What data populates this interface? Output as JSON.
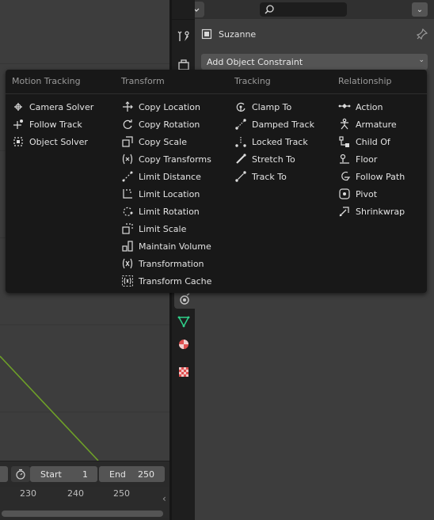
{
  "header": {
    "menu_chevron": "⌄",
    "search_placeholder": ""
  },
  "object": {
    "name": "Suzanne"
  },
  "add_constraint": {
    "label": "Add Object Constraint",
    "chevron": "⌄"
  },
  "menu": {
    "columns": [
      {
        "heading": "Motion Tracking",
        "items": [
          {
            "label": "Camera Solver",
            "icon": "camera-solver-icon"
          },
          {
            "label": "Follow Track",
            "icon": "follow-track-icon"
          },
          {
            "label": "Object Solver",
            "icon": "object-solver-icon"
          }
        ]
      },
      {
        "heading": "Transform",
        "items": [
          {
            "label": "Copy Location",
            "icon": "copy-location-icon"
          },
          {
            "label": "Copy Rotation",
            "icon": "copy-rotation-icon"
          },
          {
            "label": "Copy Scale",
            "icon": "copy-scale-icon"
          },
          {
            "label": "Copy Transforms",
            "icon": "copy-transforms-icon"
          },
          {
            "label": "Limit Distance",
            "icon": "limit-distance-icon"
          },
          {
            "label": "Limit Location",
            "icon": "limit-location-icon"
          },
          {
            "label": "Limit Rotation",
            "icon": "limit-rotation-icon"
          },
          {
            "label": "Limit Scale",
            "icon": "limit-scale-icon"
          },
          {
            "label": "Maintain Volume",
            "icon": "maintain-volume-icon"
          },
          {
            "label": "Transformation",
            "icon": "transformation-icon"
          },
          {
            "label": "Transform Cache",
            "icon": "transform-cache-icon"
          }
        ]
      },
      {
        "heading": "Tracking",
        "items": [
          {
            "label": "Clamp To",
            "icon": "clamp-to-icon"
          },
          {
            "label": "Damped Track",
            "icon": "damped-track-icon"
          },
          {
            "label": "Locked Track",
            "icon": "locked-track-icon"
          },
          {
            "label": "Stretch To",
            "icon": "stretch-to-icon"
          },
          {
            "label": "Track To",
            "icon": "track-to-icon"
          }
        ]
      },
      {
        "heading": "Relationship",
        "items": [
          {
            "label": "Action",
            "icon": "action-icon"
          },
          {
            "label": "Armature",
            "icon": "armature-icon"
          },
          {
            "label": "Child Of",
            "icon": "child-of-icon"
          },
          {
            "label": "Floor",
            "icon": "floor-icon"
          },
          {
            "label": "Follow Path",
            "icon": "follow-path-icon"
          },
          {
            "label": "Pivot",
            "icon": "pivot-icon"
          },
          {
            "label": "Shrinkwrap",
            "icon": "shrinkwrap-icon"
          }
        ]
      }
    ]
  },
  "timeline": {
    "start_label": "Start",
    "start_value": "1",
    "end_label": "End",
    "end_value": "250",
    "frames": [
      "230",
      "240",
      "250"
    ],
    "collapse_glyph": "‹"
  },
  "colors": {
    "accent_green": "#6ea028",
    "menu_bg": "#181818",
    "button_bg": "#545454",
    "constraint_tab": "#8ec0e0",
    "data_tab": "#2fd08a",
    "material_tab": "#e05050"
  }
}
